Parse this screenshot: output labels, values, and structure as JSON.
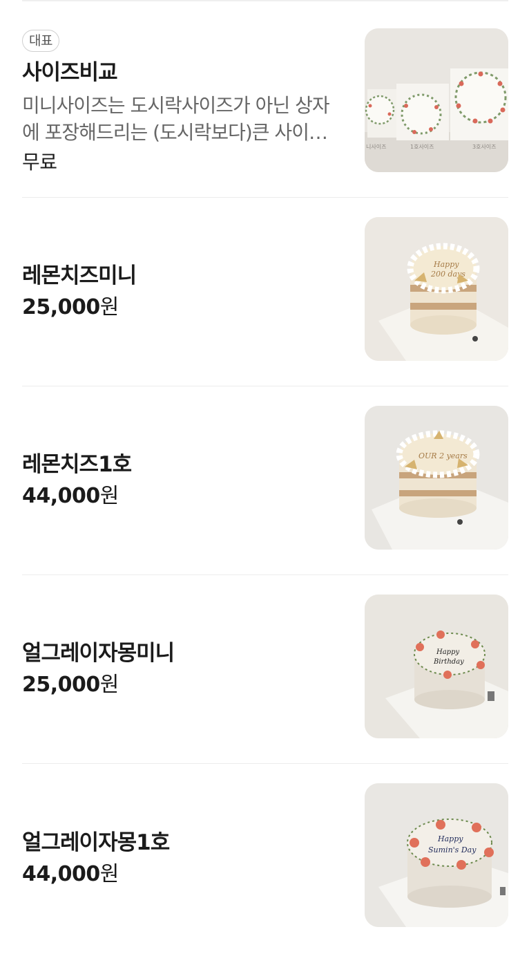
{
  "menu": {
    "items": [
      {
        "badge": "대표",
        "name": "사이즈비교",
        "description": "미니사이즈는 도시락사이즈가 아닌 상자에 포장해드리는 (도시락보다)큰 사이즈입니다.",
        "price": "무료",
        "photo_labels": [
          "니사이즈",
          "1호사이즈",
          "3호사이즈"
        ]
      },
      {
        "name": "레몬치즈미니",
        "price_number": "25,000",
        "price_unit": "원",
        "cake_writing": [
          "Happy",
          "200 days"
        ]
      },
      {
        "name": "레몬치즈1호",
        "price_number": "44,000",
        "price_unit": "원",
        "cake_writing": [
          "OUR 2 years"
        ]
      },
      {
        "name": "얼그레이자몽미니",
        "price_number": "25,000",
        "price_unit": "원",
        "cake_writing": [
          "Happy",
          "Birthday"
        ]
      },
      {
        "name": "얼그레이자몽1호",
        "price_number": "44,000",
        "price_unit": "원",
        "cake_writing": [
          "Happy",
          "Sumin's Day"
        ]
      }
    ]
  },
  "colors": {
    "text_primary": "#1b1b1b",
    "text_secondary": "#666666",
    "divider": "#ececec",
    "badge_border": "#cfcfcf"
  }
}
